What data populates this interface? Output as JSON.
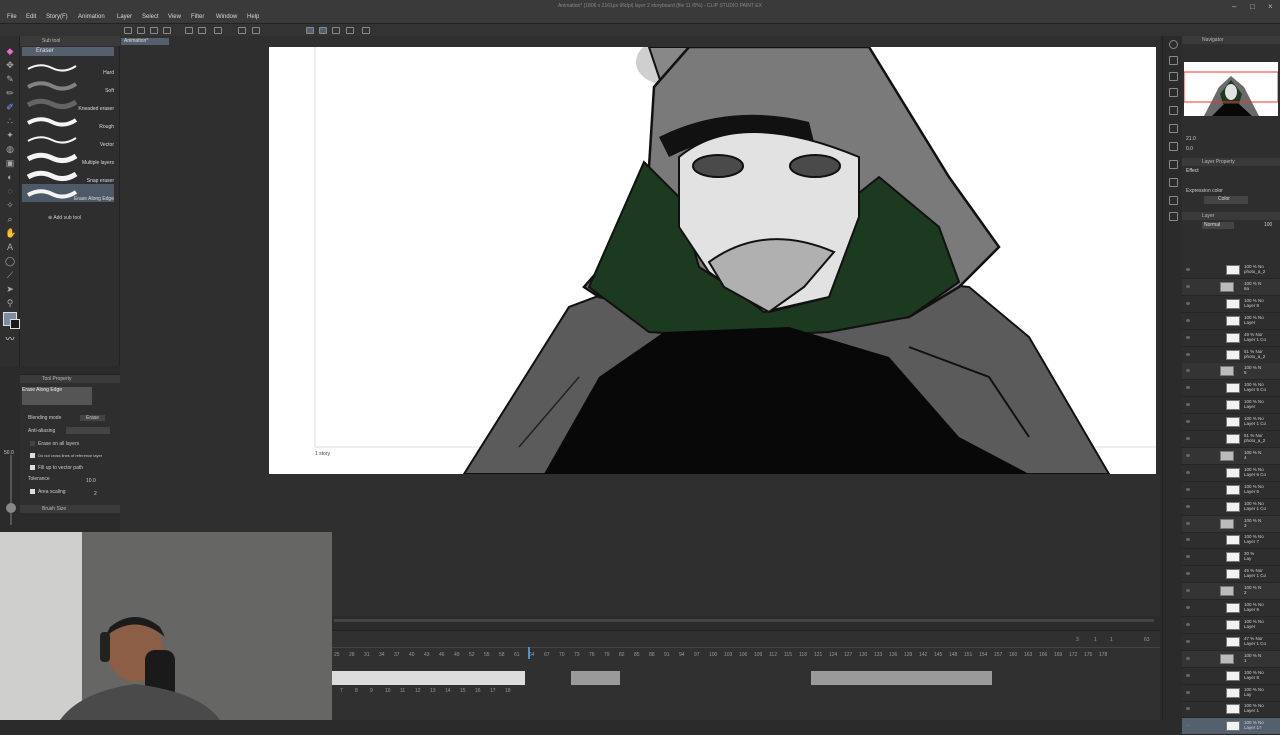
{
  "window": {
    "title": "Animation* (1806 x 2161px 96dpi) layer 2 storyboard (file 11 f0%) - CLIP STUDIO PAINT EX"
  },
  "menu": [
    "File",
    "Edit",
    "Story(F)",
    "Animation",
    "Layer",
    "Select",
    "View",
    "Filter",
    "Window",
    "Help"
  ],
  "canvas_tab": "Animation*",
  "sub_tool": {
    "header": "Sub tool",
    "tab": "Eraser",
    "brushes": [
      {
        "label": "Hard",
        "selected": false
      },
      {
        "label": "Soft",
        "selected": false
      },
      {
        "label": "Kneaded eraser",
        "selected": false
      },
      {
        "label": "Rough",
        "selected": false
      },
      {
        "label": "Vector",
        "selected": false
      },
      {
        "label": "Multiple layers",
        "selected": false
      },
      {
        "label": "Snap eraser",
        "selected": false
      },
      {
        "label": "Erase Along Edge",
        "selected": true
      }
    ],
    "add_label": "Add sub tool"
  },
  "tool_property": {
    "header": "Tool Property",
    "tool_name": "Erase Along Edge",
    "blending_label": "Blending mode",
    "blending_value": "Erase",
    "antialias_label": "Anti-aliasing",
    "options": [
      {
        "label": "Erase on all layers",
        "checked": false
      },
      {
        "label": "Do not cross lines of reference layer",
        "checked": true
      },
      {
        "label": "Fill up to vector path",
        "checked": true
      }
    ],
    "tolerance_label": "Tolerance",
    "tolerance_value": "10.0",
    "area_scaling_label": "Area scaling",
    "area_scaling_value": "2",
    "brush_size_header": "Brush Size",
    "brush_size": "50.0"
  },
  "canvas": {
    "story_label": "1 story"
  },
  "timeline": {
    "frame_numbers_top": [
      "25",
      "28",
      "31",
      "34",
      "37",
      "40",
      "43",
      "46",
      "49",
      "52",
      "55",
      "58",
      "61",
      "64",
      "67",
      "70",
      "73",
      "76",
      "79",
      "82",
      "85",
      "88",
      "91",
      "94",
      "97",
      "100",
      "103",
      "106",
      "109",
      "112",
      "115",
      "118",
      "121",
      "124",
      "127",
      "130",
      "133",
      "136",
      "139",
      "142",
      "145",
      "148",
      "151",
      "154",
      "157",
      "160",
      "163",
      "166",
      "169",
      "172",
      "175",
      "178"
    ],
    "cell_numbers": [
      "7",
      "8",
      "9",
      "10",
      "11",
      "12",
      "13",
      "14",
      "15",
      "16",
      "17",
      "18"
    ],
    "counter": [
      "3",
      "1",
      "1",
      "63"
    ]
  },
  "right_panel": {
    "navigator_label": "Navigator",
    "zoom_value": "21.0",
    "angle_value": "0.0",
    "layer_property_label": "Layer Property",
    "effect_label": "Effect",
    "expression_label": "Expression color",
    "expression_value": "Color",
    "layer_panel_label": "Layer",
    "blend_mode": "Normal",
    "opacity": "100",
    "layers": [
      {
        "text": "100 % No\nphoto_a_2",
        "type": "layer"
      },
      {
        "text": "100 % N\n6a",
        "type": "folder"
      },
      {
        "text": "100 % No\nLayer 8",
        "type": "layer"
      },
      {
        "text": "100 % No\nLayer",
        "type": "layer"
      },
      {
        "text": "49 % Nor\nLayer 1 Co",
        "type": "layer"
      },
      {
        "text": "51 % Nor\nphoto_a_2",
        "type": "layer"
      },
      {
        "text": "100 % N\n5",
        "type": "folder"
      },
      {
        "text": "100 % No\nLayer 5 Co",
        "type": "layer"
      },
      {
        "text": "100 % No\nLayer",
        "type": "layer"
      },
      {
        "text": "100 % No\nLayer 1 Co",
        "type": "layer"
      },
      {
        "text": "51 % Nor\nphoto_a_2",
        "type": "layer"
      },
      {
        "text": "100 % N\n4",
        "type": "folder"
      },
      {
        "text": "100 % No\nLayer 6 Co",
        "type": "layer"
      },
      {
        "text": "100 % No\nLayer 6",
        "type": "layer"
      },
      {
        "text": "100 % No\nLayer 1 Co",
        "type": "layer"
      },
      {
        "text": "100 % N\n3",
        "type": "folder"
      },
      {
        "text": "100 % No\nLayer 7",
        "type": "layer"
      },
      {
        "text": "30 %\nLay",
        "type": "layer"
      },
      {
        "text": "45 % Nor\nLayer 1 Co",
        "type": "layer"
      },
      {
        "text": "100 % N\n2",
        "type": "folder"
      },
      {
        "text": "100 % No\nLayer 6",
        "type": "layer"
      },
      {
        "text": "100 % No\nLayer",
        "type": "layer"
      },
      {
        "text": "47 % Nor\nLayer 1 Co",
        "type": "layer"
      },
      {
        "text": "100 % N\n1",
        "type": "folder"
      },
      {
        "text": "100 % No\nLayer 8",
        "type": "layer"
      },
      {
        "text": "100 % No\nLay",
        "type": "layer"
      },
      {
        "text": "100 % No\nLayer 1",
        "type": "layer"
      },
      {
        "text": "100 % No\nLayer 17",
        "type": "selected"
      }
    ]
  },
  "colors": {
    "ui_dark": "#2e2e2e",
    "ui_selected": "#55606e",
    "hood_grey": "#7a7a7a",
    "mask_white": "#e2e2e2",
    "green_lining": "#1c3a1f",
    "robe_black": "#080808"
  }
}
